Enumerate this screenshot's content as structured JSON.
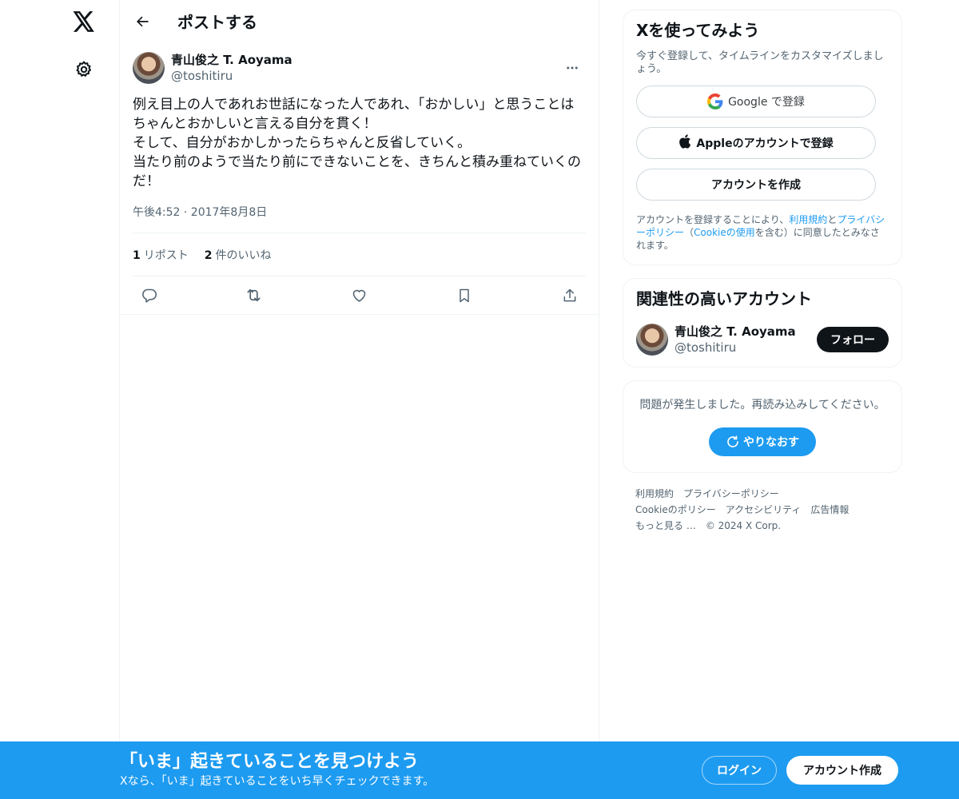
{
  "nav": {
    "logo_icon": "x-logo-icon",
    "settings_icon": "gear-icon"
  },
  "header": {
    "title": "ポストする",
    "back_icon": "arrow-left-icon"
  },
  "post": {
    "author_name": "青山俊之 T. Aoyama",
    "author_handle": "@toshitiru",
    "text": "例え目上の人であれお世話になった人であれ、「おかしい」と思うことはちゃんとおかしいと言える自分を貫く！\nそして、自分がおかしかったらちゃんと反省していく。\n当たり前のようで当たり前にできないことを、きちんと積み重ねていくのだ！",
    "timestamp": "午後4:52 · 2017年8月8日",
    "reposts_count": "1",
    "reposts_label": "リポスト",
    "likes_count": "2",
    "likes_label": "件のいいね",
    "action_icons": [
      "reply-icon",
      "repost-icon",
      "like-icon",
      "bookmark-icon",
      "share-icon"
    ]
  },
  "signup": {
    "title": "Xを使ってみよう",
    "subtitle": "今すぐ登録して、タイムラインをカスタマイズしましょう。",
    "google_label": "Google で登録",
    "apple_label": "Appleのアカウントで登録",
    "create_label": "アカウントを作成",
    "terms_pre": "アカウントを登録することにより、",
    "terms_link1": "利用規約",
    "terms_and": "と",
    "terms_link2": "プライバシーポリシー",
    "terms_mid": "（",
    "terms_link3": "Cookieの使用",
    "terms_post": "を含む）に同意したとみなされます。"
  },
  "related": {
    "title": "関連性の高いアカウント",
    "name": "青山俊之 T. Aoyama",
    "handle": "@toshitiru",
    "follow_label": "フォロー"
  },
  "error": {
    "message": "問題が発生しました。再読み込みしてください。",
    "retry_label": "やりなおす"
  },
  "footer": {
    "links": [
      "利用規約",
      "プライバシーポリシー",
      "Cookieのポリシー",
      "アクセシビリティ",
      "広告情報",
      "もっと見る …"
    ],
    "copyright": "© 2024 X Corp."
  },
  "banner": {
    "title": "「いま」起きていることを見つけよう",
    "subtitle": "Xなら、「いま」起きていることをいち早くチェックできます。",
    "login_label": "ログイン",
    "signup_label": "アカウント作成"
  },
  "colors": {
    "accent": "#1d9bf0",
    "text": "#0f1419",
    "secondary": "#536471",
    "border": "#eff3f4"
  }
}
